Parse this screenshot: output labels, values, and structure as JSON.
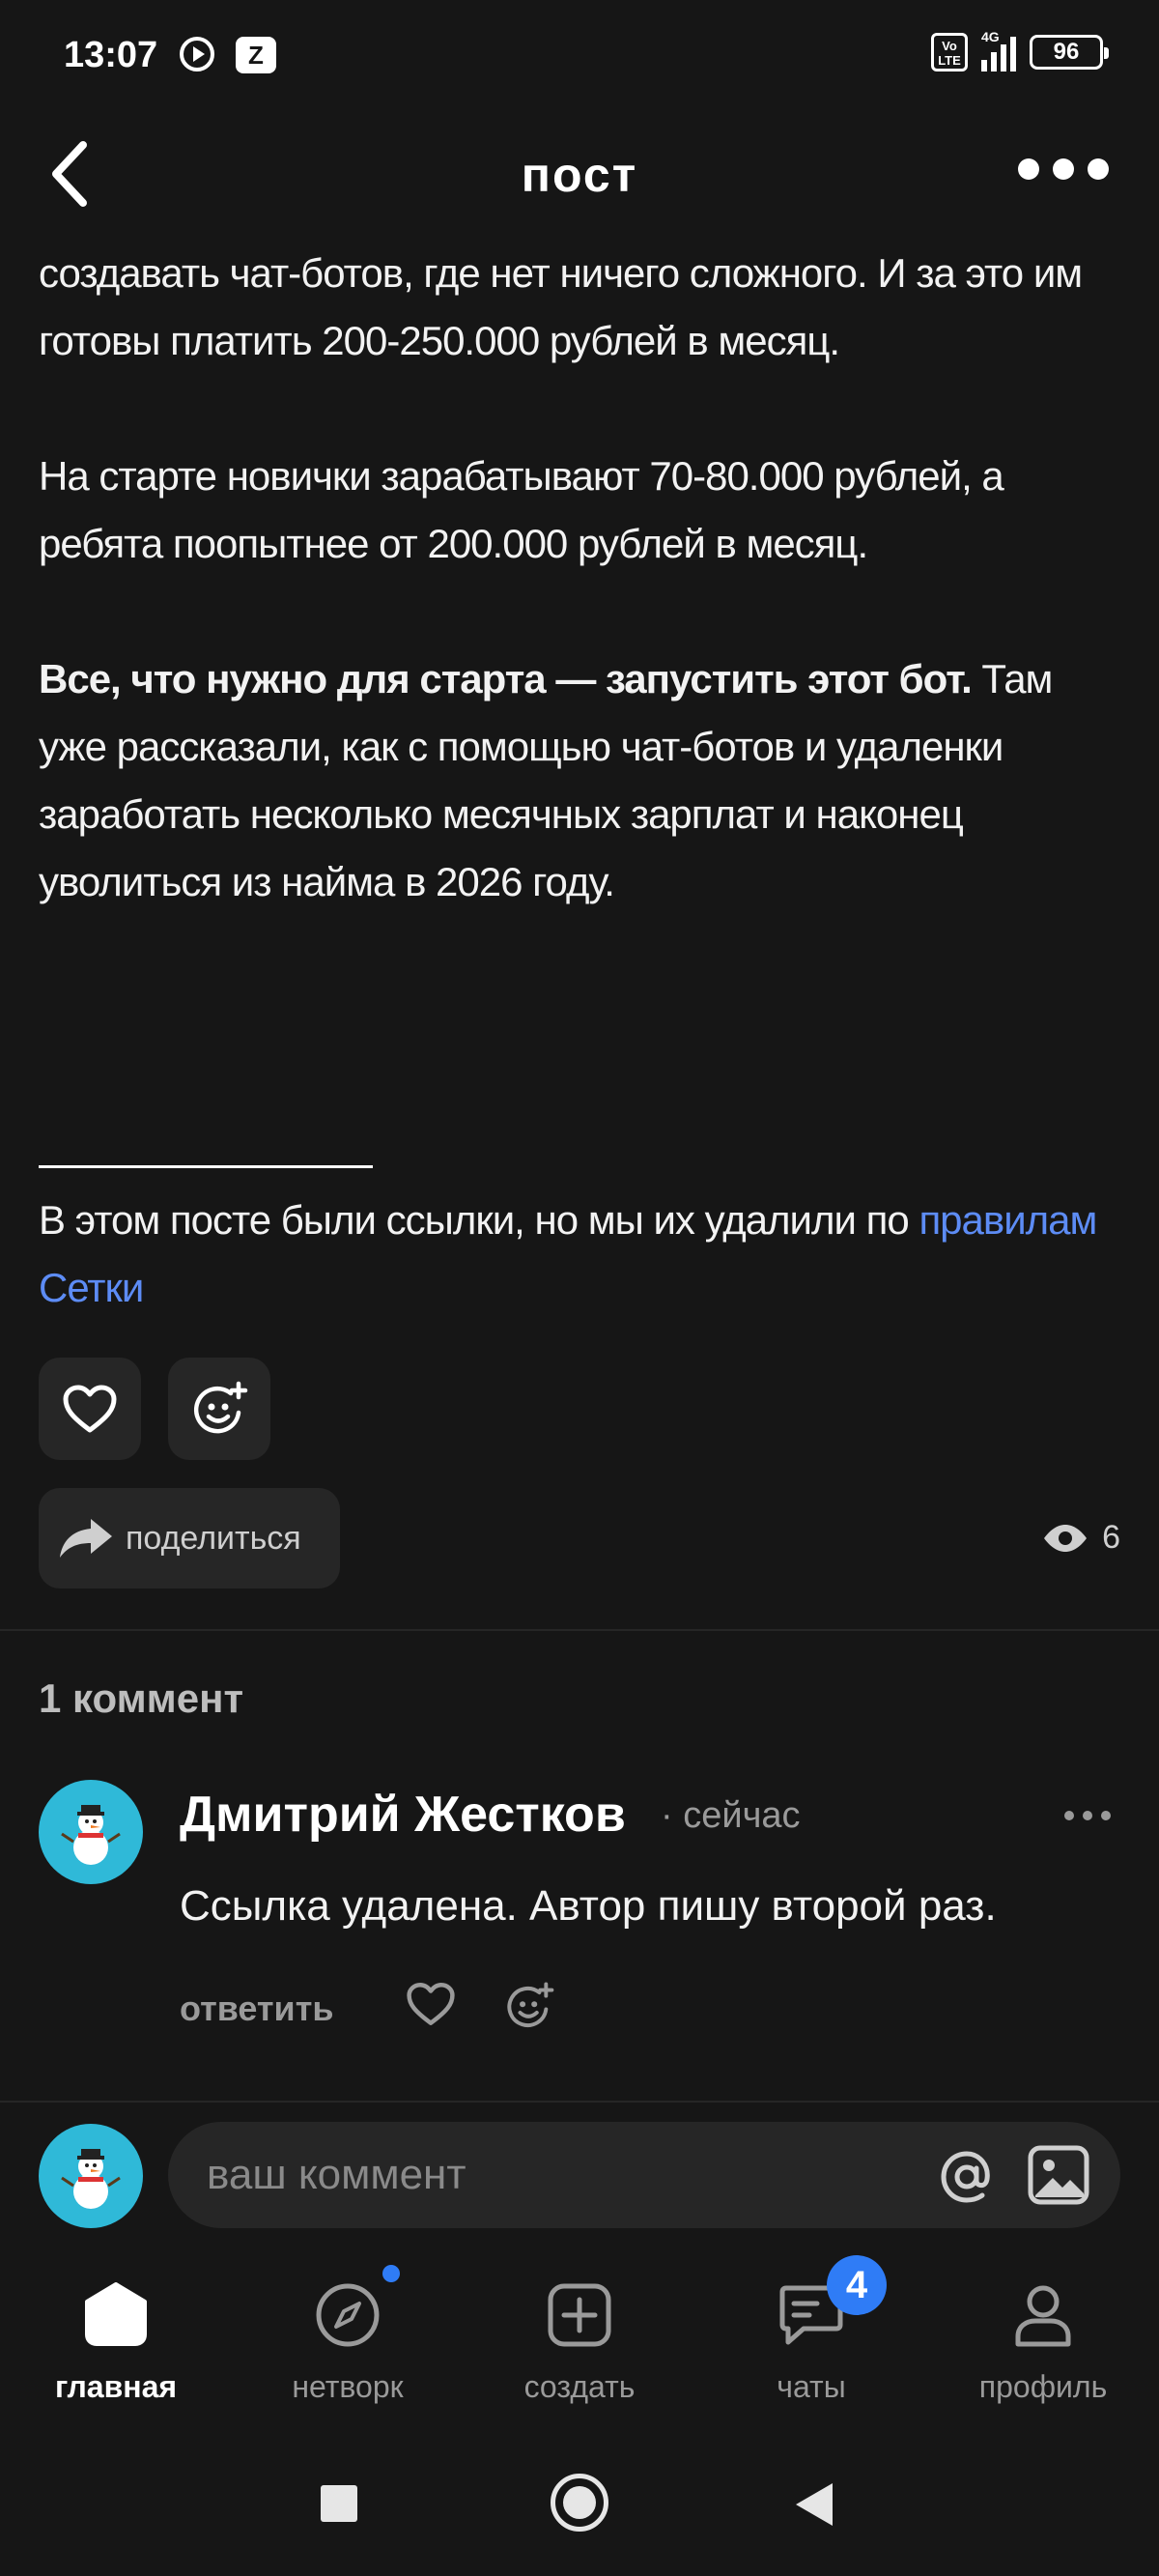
{
  "status_bar": {
    "time": "13:07",
    "app_icon_letter": "Z",
    "lte_label": "Vo LTE",
    "network": "4G",
    "battery": "96"
  },
  "header": {
    "title": "пост"
  },
  "post": {
    "paragraph1": "создавать чат-ботов, где нет ничего сложного. И за это им готовы платить 200-250.000 рублей в месяц.",
    "paragraph2": "На старте новички зарабатывают 70-80.000 рублей, а ребята поопытнее от 200.000 рублей в месяц.",
    "paragraph3_bold": "Все, что нужно для старта — запустить этот бот.",
    "paragraph3_rest": " Там уже рассказали, как с помощью чат-ботов и удаленки заработать несколько месячных зарплат и наконец уволиться из найма в 2026 году.",
    "notice_text": "В этом посте были ссылки, но мы их удалили по ",
    "notice_link": "правилам Сетки"
  },
  "actions": {
    "share_label": "поделиться",
    "views_count": "6"
  },
  "comments": {
    "count_label": "1 коммент",
    "items": [
      {
        "author": "Дмитрий Жестков",
        "time": "· сейчас",
        "text": "Ссылка удалена. Автор пишу второй раз.",
        "reply_label": "ответить"
      }
    ]
  },
  "comment_input": {
    "placeholder": "ваш коммент"
  },
  "bottom_nav": {
    "items": [
      {
        "label": "главная",
        "icon": "home-icon",
        "active": true
      },
      {
        "label": "нетворк",
        "icon": "compass-icon",
        "active": false
      },
      {
        "label": "создать",
        "icon": "plus-square-icon",
        "active": false
      },
      {
        "label": "чаты",
        "icon": "chat-icon",
        "active": false,
        "badge": "4"
      },
      {
        "label": "профиль",
        "icon": "profile-icon",
        "active": false
      }
    ]
  },
  "colors": {
    "background": "#161616",
    "surface": "#262626",
    "accent": "#2f7cf6",
    "link": "#5d8cf5",
    "avatar": "#2fb9d8"
  }
}
